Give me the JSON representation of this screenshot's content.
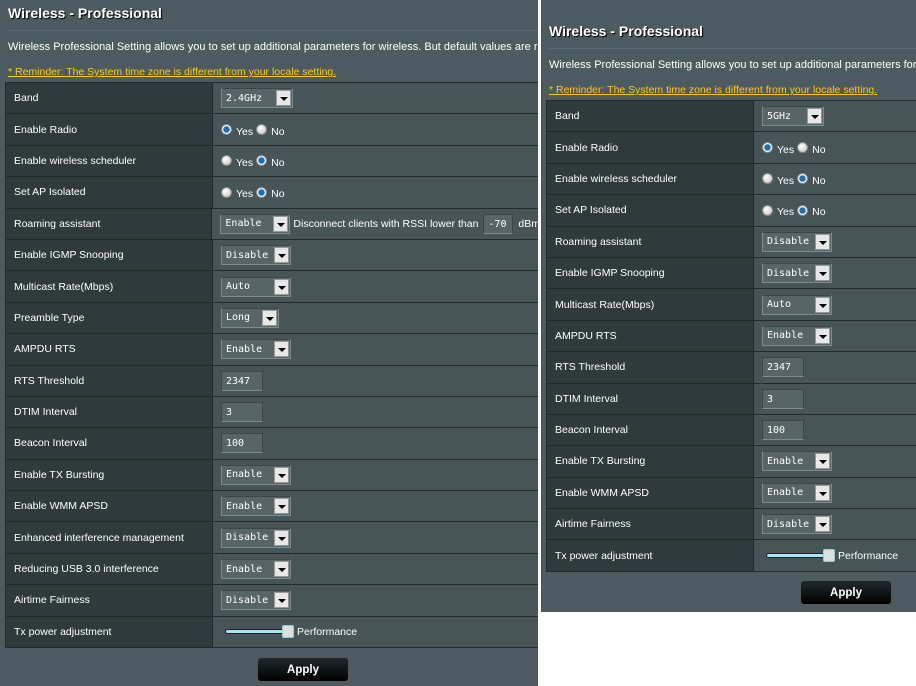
{
  "panels": [
    {
      "id": "left",
      "title": "Wireless - Professional",
      "description": "Wireless Professional Setting allows you to set up additional parameters for wireless. But default values are recommended.",
      "reminder": "* Reminder: The System time zone is different from your locale setting.",
      "apply_label": "Apply",
      "rows": [
        {
          "label": "Band",
          "type": "select",
          "value": "2.4GHz"
        },
        {
          "label": "Enable Radio",
          "type": "radio",
          "options": [
            "Yes",
            "No"
          ],
          "selected": "Yes"
        },
        {
          "label": "Enable wireless scheduler",
          "type": "radio",
          "options": [
            "Yes",
            "No"
          ],
          "selected": "No"
        },
        {
          "label": "Set AP Isolated",
          "type": "radio",
          "options": [
            "Yes",
            "No"
          ],
          "selected": "No"
        },
        {
          "label": "Roaming assistant",
          "type": "roaming",
          "value": "Enable",
          "text": "Disconnect clients with RSSI lower than",
          "rssi": "-70",
          "unit": "dBm"
        },
        {
          "label": "Enable IGMP Snooping",
          "type": "select",
          "value": "Disable"
        },
        {
          "label": "Multicast Rate(Mbps)",
          "type": "select",
          "value": "Auto"
        },
        {
          "label": "Preamble Type",
          "type": "select",
          "value": "Long"
        },
        {
          "label": "AMPDU RTS",
          "type": "select",
          "value": "Enable"
        },
        {
          "label": "RTS Threshold",
          "type": "text",
          "value": "2347"
        },
        {
          "label": "DTIM Interval",
          "type": "text",
          "value": "3"
        },
        {
          "label": "Beacon Interval",
          "type": "text",
          "value": "100"
        },
        {
          "label": "Enable TX Bursting",
          "type": "select",
          "value": "Enable"
        },
        {
          "label": "Enable WMM APSD",
          "type": "select",
          "value": "Enable"
        },
        {
          "label": "Enhanced interference management",
          "type": "select",
          "value": "Disable"
        },
        {
          "label": "Reducing USB 3.0 interference",
          "type": "select",
          "value": "Enable"
        },
        {
          "label": "Airtime Fairness",
          "type": "select",
          "value": "Disable"
        },
        {
          "label": "Tx power adjustment",
          "type": "slider",
          "level_percent": 100,
          "text": "Performance"
        }
      ]
    },
    {
      "id": "right",
      "title": "Wireless - Professional",
      "description": "Wireless Professional Setting allows you to set up additional parameters for wireless.",
      "reminder": "* Reminder: The System time zone is different from your locale setting.",
      "apply_label": "Apply",
      "rows": [
        {
          "label": "Band",
          "type": "select",
          "value": "5GHz"
        },
        {
          "label": "Enable Radio",
          "type": "radio",
          "options": [
            "Yes",
            "No"
          ],
          "selected": "Yes"
        },
        {
          "label": "Enable wireless scheduler",
          "type": "radio",
          "options": [
            "Yes",
            "No"
          ],
          "selected": "No"
        },
        {
          "label": "Set AP Isolated",
          "type": "radio",
          "options": [
            "Yes",
            "No"
          ],
          "selected": "No"
        },
        {
          "label": "Roaming assistant",
          "type": "select",
          "value": "Disable"
        },
        {
          "label": "Enable IGMP Snooping",
          "type": "select",
          "value": "Disable"
        },
        {
          "label": "Multicast Rate(Mbps)",
          "type": "select",
          "value": "Auto"
        },
        {
          "label": "AMPDU RTS",
          "type": "select",
          "value": "Enable"
        },
        {
          "label": "RTS Threshold",
          "type": "text",
          "value": "2347"
        },
        {
          "label": "DTIM Interval",
          "type": "text",
          "value": "3"
        },
        {
          "label": "Beacon Interval",
          "type": "text",
          "value": "100"
        },
        {
          "label": "Enable TX Bursting",
          "type": "select",
          "value": "Enable"
        },
        {
          "label": "Enable WMM APSD",
          "type": "select",
          "value": "Enable"
        },
        {
          "label": "Airtime Fairness",
          "type": "select",
          "value": "Disable"
        },
        {
          "label": "Tx power adjustment",
          "type": "slider",
          "level_percent": 100,
          "text": "Performance"
        }
      ]
    }
  ],
  "colors": {
    "reminder": "#ffcc00",
    "background": "#4d5b60",
    "label_cell": "#2e3a3c",
    "value_cell": "#475559",
    "slider_fill": "#a8e6f6"
  }
}
